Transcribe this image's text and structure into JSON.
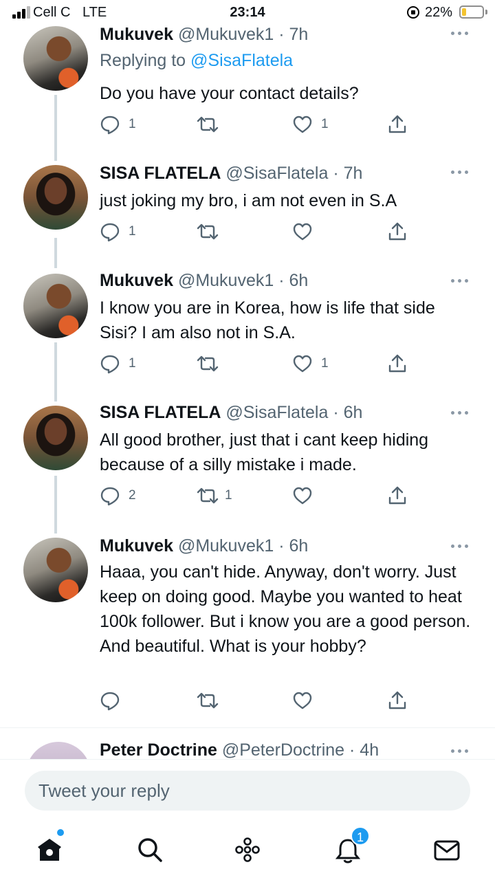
{
  "status_bar": {
    "carrier": "Cell C",
    "network": "LTE",
    "time": "23:14",
    "battery": "22%",
    "battery_level": 0.22
  },
  "tweets": [
    {
      "name": "Mukuvek",
      "handle": "@Mukuvek1",
      "time": "7h",
      "replying_label": "Replying to",
      "replying_to": "@SisaFlatela",
      "text": "Do you have your contact details?",
      "replies": "1",
      "retweets": "",
      "likes": "1",
      "avatar": "avatar-mukuvek"
    },
    {
      "name": "SISA FLATELA",
      "handle": "@SisaFlatela",
      "time": "7h",
      "text": "just joking my bro, i am not even in S.A",
      "replies": "1",
      "retweets": "",
      "likes": "",
      "avatar": "avatar-sisa"
    },
    {
      "name": "Mukuvek",
      "handle": "@Mukuvek1",
      "time": "6h",
      "text": "I know you are in Korea, how is life that side Sisi? I am also not in S.A.",
      "replies": "1",
      "retweets": "",
      "likes": "1",
      "avatar": "avatar-mukuvek"
    },
    {
      "name": "SISA FLATELA",
      "handle": "@SisaFlatela",
      "time": "6h",
      "text": "All good brother, just that i cant keep hiding because of a silly mistake i made.",
      "replies": "2",
      "retweets": "1",
      "likes": "",
      "avatar": "avatar-sisa"
    },
    {
      "name": "Mukuvek",
      "handle": "@Mukuvek1",
      "time": "6h",
      "text": "Haaa, you can't hide. Anyway, don't worry. Just keep on doing good. Maybe you wanted to heat 100k follower. But i know you are a good person. And beautiful. What is your hobby?",
      "replies": "",
      "retweets": "",
      "likes": "",
      "avatar": "avatar-mukuvek"
    },
    {
      "name": "Peter Doctrine",
      "handle": "@PeterDoctrine",
      "time": "4h",
      "avatar": "avatar-peter"
    }
  ],
  "reply_bar": {
    "placeholder": "Tweet your reply"
  },
  "nav": {
    "items": [
      "home-icon",
      "search-icon",
      "spaces-icon",
      "notifications-icon",
      "messages-icon"
    ],
    "notifications_badge": "1"
  },
  "colors": {
    "accent": "#1d9bf0",
    "secondary_text": "#536471",
    "thread_line": "#cfd9de"
  }
}
